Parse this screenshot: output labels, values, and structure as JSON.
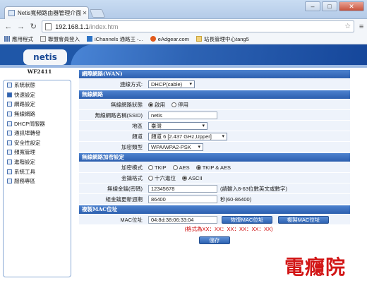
{
  "browser": {
    "tab_title": "Netis寬頻路由器管理介面",
    "url_host": "192.168.1.1",
    "url_path": "/index.htm",
    "bookmarks": [
      "應用程式",
      "聯盟會員登入",
      "iChannels 通路王 -...",
      "eAdgear.com",
      "站長管理中心tang5"
    ]
  },
  "brand": {
    "logo": "netis",
    "model": "WF2411"
  },
  "sidebar": {
    "items": [
      {
        "label": "系統狀態",
        "icon": "status-icon"
      },
      {
        "label": "快速設定",
        "icon": "quick-setup-icon"
      },
      {
        "label": "網路設定",
        "icon": "network-icon"
      },
      {
        "label": "無線網路",
        "icon": "wireless-icon"
      },
      {
        "label": "DHCP伺服器",
        "icon": "dhcp-icon"
      },
      {
        "label": "通訊埠轉發",
        "icon": "port-forward-icon"
      },
      {
        "label": "安全性設定",
        "icon": "security-icon"
      },
      {
        "label": "頻寬管理",
        "icon": "bandwidth-icon"
      },
      {
        "label": "進階設定",
        "icon": "advanced-icon"
      },
      {
        "label": "系統工具",
        "icon": "tools-icon"
      },
      {
        "label": "服務專區",
        "icon": "service-icon"
      }
    ]
  },
  "wan": {
    "section_title": "網際網路(WAN)",
    "type_label": "連線方式:",
    "type_value": "DHCP(cable)"
  },
  "wireless": {
    "section_title": "無線網路",
    "status_label": "無線網路狀態",
    "status_on": "啟用",
    "status_off": "停用",
    "ssid_label": "無線網路名稱(SSID)",
    "ssid_value": "netis",
    "region_label": "地區",
    "region_value": "臺灣",
    "channel_label": "頻道",
    "channel_value": "頻道 6 [2.437 GHz,Upper]",
    "mode_label": "加密類型",
    "mode_value": "WPA/WPA2-PSK"
  },
  "security": {
    "section_title": "無線網路加密設定",
    "cipher_label": "加密模式",
    "cipher_tkip": "TKIP",
    "cipher_aes": "AES",
    "cipher_both": "TKIP & AES",
    "key_format_label": "金鑰格式",
    "key_format_hex": "十六進位",
    "key_format_ascii": "ASCII",
    "key_label": "無線金鑰(密碼)",
    "key_value": "12345678",
    "key_hint": "(請輸入8-63位數英文或數字)",
    "renew_label": "組金鑰更新週期",
    "renew_value": "86400",
    "renew_hint": "秒(60-86400)"
  },
  "mac": {
    "section_title": "複製MAC位址",
    "mac_label": "MAC位址",
    "mac_value": "04:8d:38:06:33:04",
    "restore_button": "恢復MAC位址",
    "clone_button": "複製MAC位址",
    "format_hint": "(格式為XX：XX：XX：XX：XX：XX)"
  },
  "save_button": "儲存",
  "watermark": "電癮院"
}
